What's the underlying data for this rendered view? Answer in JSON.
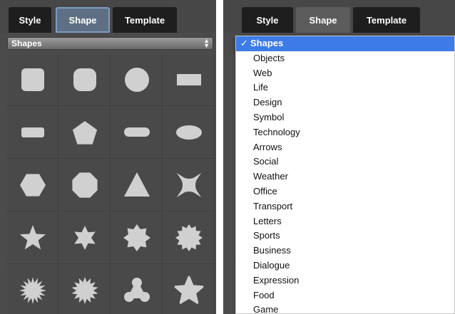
{
  "tabs": {
    "style": "Style",
    "shape": "Shape",
    "template": "Template"
  },
  "category_select": {
    "value": "Shapes"
  },
  "shapes": [
    "rounded-square-icon",
    "rounded-square-large-icon",
    "circle-icon",
    "rectangle-icon",
    "pill-small-icon",
    "pentagon-icon",
    "pill-icon",
    "ellipse-icon",
    "hexagon-icon",
    "octagon-icon",
    "triangle-icon",
    "concave-star-icon",
    "star-5-icon",
    "star-6-icon",
    "star-8-icon",
    "star-12-icon",
    "starburst-icon",
    "starburst-2-icon",
    "trefoil-icon",
    "rounded-star-icon"
  ],
  "dropdown": {
    "check": "✓",
    "items": [
      "Shapes",
      "Objects",
      "Web",
      "Life",
      "Design",
      "Symbol",
      "Technology",
      "Arrows",
      "Social",
      "Weather",
      "Office",
      "Transport",
      "Letters",
      "Sports",
      "Business",
      "Dialogue",
      "Expression",
      "Food",
      "Game"
    ]
  },
  "colors": {
    "panel": "#4b4b4b",
    "tab": "#1e1e1e",
    "active_tab": "#5f6f83",
    "selection": "#3d7be8",
    "shape": "#d0d0d0"
  }
}
